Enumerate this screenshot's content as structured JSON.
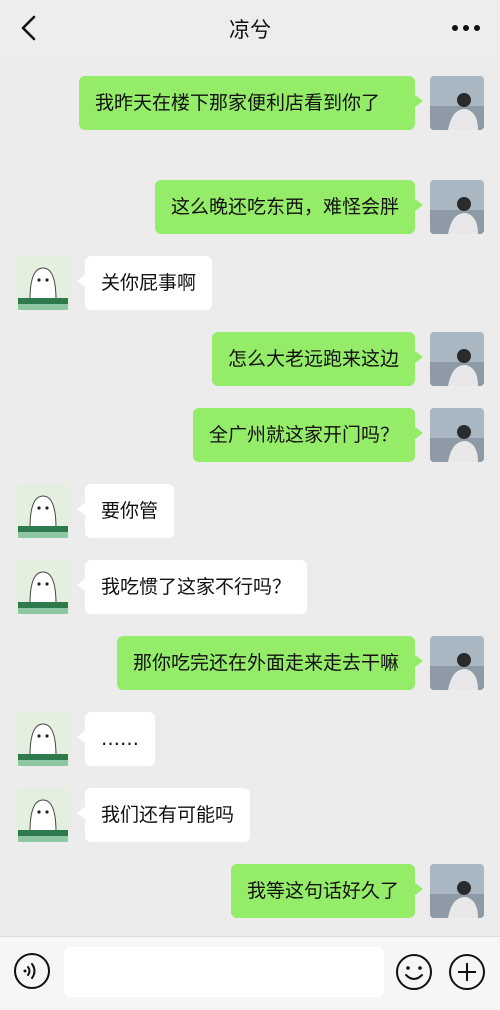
{
  "header": {
    "title": "凉兮",
    "back_icon": "chevron-left-icon",
    "more_icon": "more-dots-icon"
  },
  "messages": [
    {
      "from": "me",
      "text": "我昨天在楼下那家便利店看到你了"
    },
    {
      "from": "me",
      "text": "这么晚还吃东西，难怪会胖"
    },
    {
      "from": "other",
      "text": "关你屁事啊"
    },
    {
      "from": "me",
      "text": "怎么大老远跑来这边"
    },
    {
      "from": "me",
      "text": "全广州就这家开门吗？"
    },
    {
      "from": "other",
      "text": "要你管"
    },
    {
      "from": "other",
      "text": "我吃惯了这家不行吗？"
    },
    {
      "from": "me",
      "text": "那你吃完还在外面走来走去干嘛"
    },
    {
      "from": "other",
      "text": "……"
    },
    {
      "from": "other",
      "text": "我们还有可能吗"
    },
    {
      "from": "me",
      "text": "我等这句话好久了"
    }
  ],
  "footer": {
    "voice_icon": "voice-icon",
    "emoji_icon": "emoji-icon",
    "plus_icon": "plus-icon",
    "input_value": ""
  },
  "colors": {
    "background": "#ececec",
    "my_bubble": "#95ec69",
    "their_bubble": "#ffffff"
  }
}
